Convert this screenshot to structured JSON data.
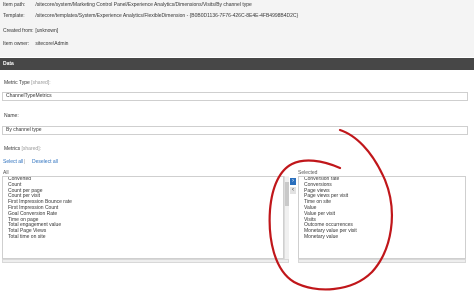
{
  "info": {
    "item_path_label": "Item path:",
    "item_path_value": "/sitecore/system/Marketing Control Panel/Experience Analytics/Dimensions/Visits/By channel type",
    "template_label": "Template:",
    "template_value": "/sitecore/templates/System/Experience Analytics/FlexibleDimension - {B0B0D1136-7F76-426C-8E4E-4FB4998B4D2C}",
    "created_from_label": "Created from:",
    "created_from_value": "[unknown]",
    "item_owner_label": "Item owner:",
    "item_owner_value": "sitecore\\Admin"
  },
  "section": {
    "title": "Data"
  },
  "metric_type": {
    "label": "Metric Type",
    "shared": "[shared]:",
    "value": "ChannelTypeMetrics"
  },
  "name": {
    "label": "Name:",
    "value": "By channel type"
  },
  "metrics": {
    "label": "Metrics",
    "shared": "[shared]:",
    "select_all": "Select all",
    "separator": "|",
    "deselect_all": "Deselect all",
    "all_title": "All",
    "selected_title": "Selected",
    "all_items": [
      "Converted",
      "Count",
      "Count per page",
      "Count per visit",
      "First Impression Bounce rate",
      "First Impression Count",
      "Goal Conversion Rate",
      "Time on page",
      "Total engagement value",
      "Total Page Views",
      "Total time on site"
    ],
    "selected_items": [
      "Conversion rate",
      "Conversions",
      "Page views",
      "Page views per visit",
      "Time on site",
      "Value",
      "Value per visit",
      "Visits",
      "Outcome occurrences",
      "Monetary value per visit",
      "Monetary value"
    ],
    "add_arrow": "›",
    "remove_arrow": "‹"
  },
  "annotation": {
    "color": "#c0161a"
  }
}
